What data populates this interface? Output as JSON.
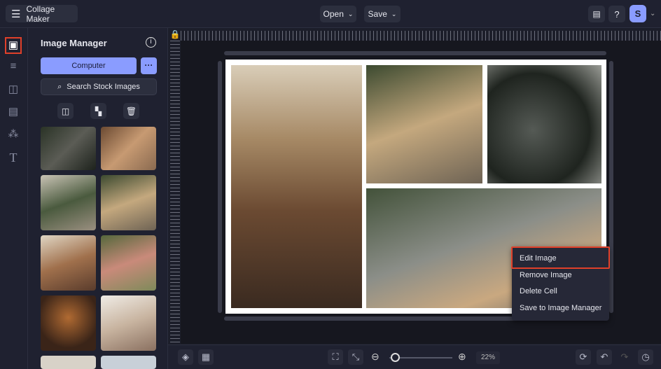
{
  "header": {
    "menu_icon": "hamburger-icon",
    "app_title": "Collage Maker",
    "open_label": "Open",
    "save_label": "Save",
    "avatar_letter": "S"
  },
  "rail": {
    "items": [
      "image-icon",
      "sliders-icon",
      "layout-icon",
      "background-icon",
      "elements-icon",
      "text-icon"
    ]
  },
  "panel": {
    "title": "Image Manager",
    "computer_label": "Computer",
    "more_label": "···",
    "search_label": "Search Stock Images"
  },
  "context_menu": {
    "items": [
      "Edit Image",
      "Remove Image",
      "Delete Cell",
      "Save to Image Manager"
    ]
  },
  "bottom": {
    "zoom_value": "22%",
    "zoom_fraction": 0.05
  },
  "colors": {
    "accent": "#8a9cff",
    "highlight": "#e0402a",
    "bg": "#1f2130"
  }
}
